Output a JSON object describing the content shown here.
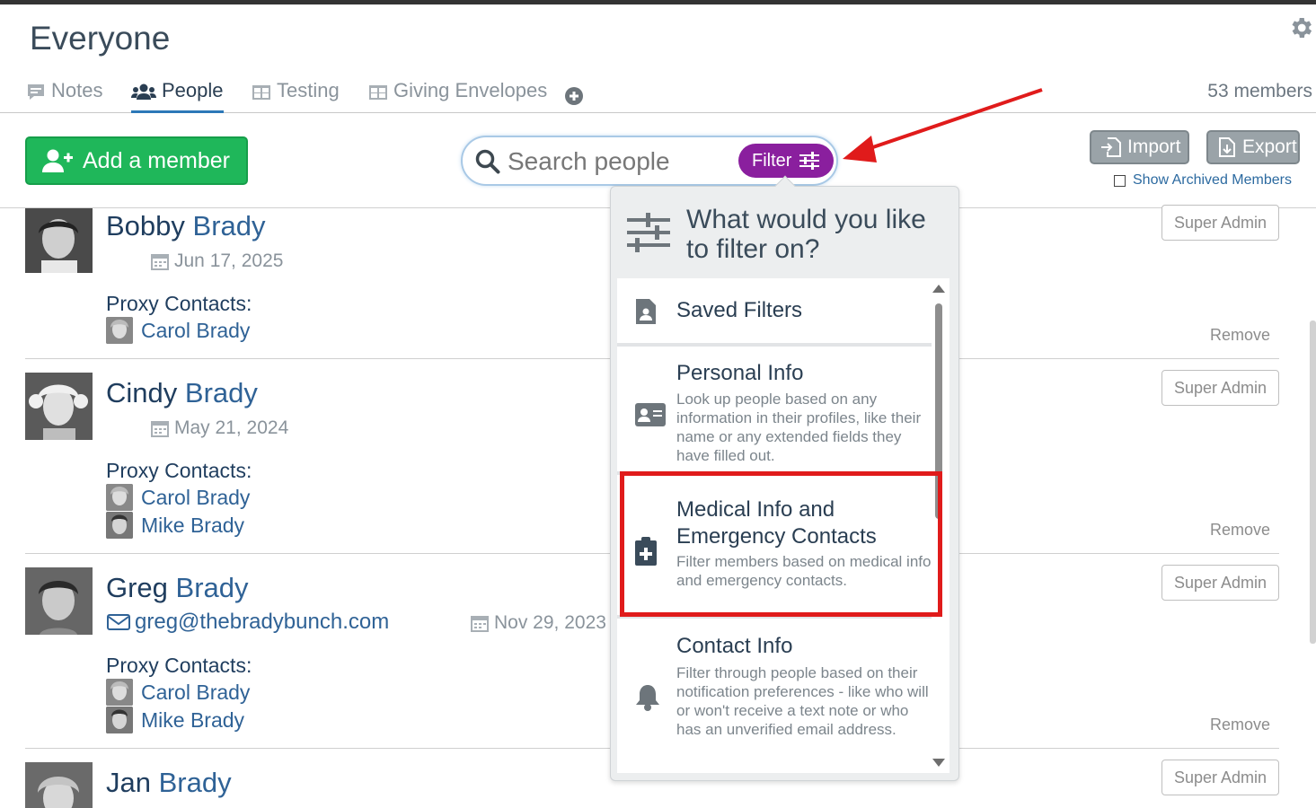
{
  "page": {
    "title": "Everyone",
    "members_count": "53 members"
  },
  "tabs": [
    {
      "label": "Notes",
      "icon": "comment-icon"
    },
    {
      "label": "People",
      "icon": "users-icon",
      "active": true
    },
    {
      "label": "Testing",
      "icon": "table-icon"
    },
    {
      "label": "Giving Envelopes",
      "icon": "table-icon"
    }
  ],
  "toolbar": {
    "add_member_label": "Add a member",
    "search_placeholder": "Search people",
    "filter_label": "Filter",
    "import_label": "Import",
    "export_label": "Export",
    "show_archived_label": "Show Archived Members"
  },
  "people": [
    {
      "first": "Bobby",
      "last": "Brady",
      "date": "Jun 17, 2025",
      "email": "",
      "proxy_label": "Proxy Contacts:",
      "proxies": [
        "Carol Brady"
      ],
      "role": "Super Admin",
      "remove": "Remove"
    },
    {
      "first": "Cindy",
      "last": "Brady",
      "date": "May 21, 2024",
      "email": "",
      "proxy_label": "Proxy Contacts:",
      "proxies": [
        "Carol Brady",
        "Mike Brady"
      ],
      "role": "Super Admin",
      "remove": "Remove"
    },
    {
      "first": "Greg",
      "last": "Brady",
      "date": "Nov 29, 2023",
      "email": "greg@thebradybunch.com",
      "proxy_label": "Proxy Contacts:",
      "proxies": [
        "Carol Brady",
        "Mike Brady"
      ],
      "role": "Super Admin",
      "remove": "Remove"
    },
    {
      "first": "Jan",
      "last": "Brady",
      "role": "Super Admin"
    }
  ],
  "filter_panel": {
    "title": "What would you like to filter on?",
    "items": [
      {
        "title": "Saved Filters",
        "description": "",
        "icon": "saved-file-icon"
      },
      {
        "title": "Personal Info",
        "description": "Look up people based on any information in their profiles, like their name or any extended fields they have filled out.",
        "icon": "id-card-icon"
      },
      {
        "title": "Medical Info and Emergency Contacts",
        "description": "Filter members based on medical info and emergency contacts.",
        "icon": "medical-clipboard-icon",
        "highlighted": true
      },
      {
        "title": "Contact Info",
        "description": "Filter through people based on their notification preferences - like who will or won't receive a text note or who has an unverified email address.",
        "icon": "bell-icon"
      }
    ]
  },
  "colors": {
    "add_button": "#1fb75a",
    "filter_button": "#8a1f9e",
    "highlight_border": "#e01b1b",
    "link_blue": "#2f6296",
    "active_tab_underline": "#2c78b8"
  }
}
